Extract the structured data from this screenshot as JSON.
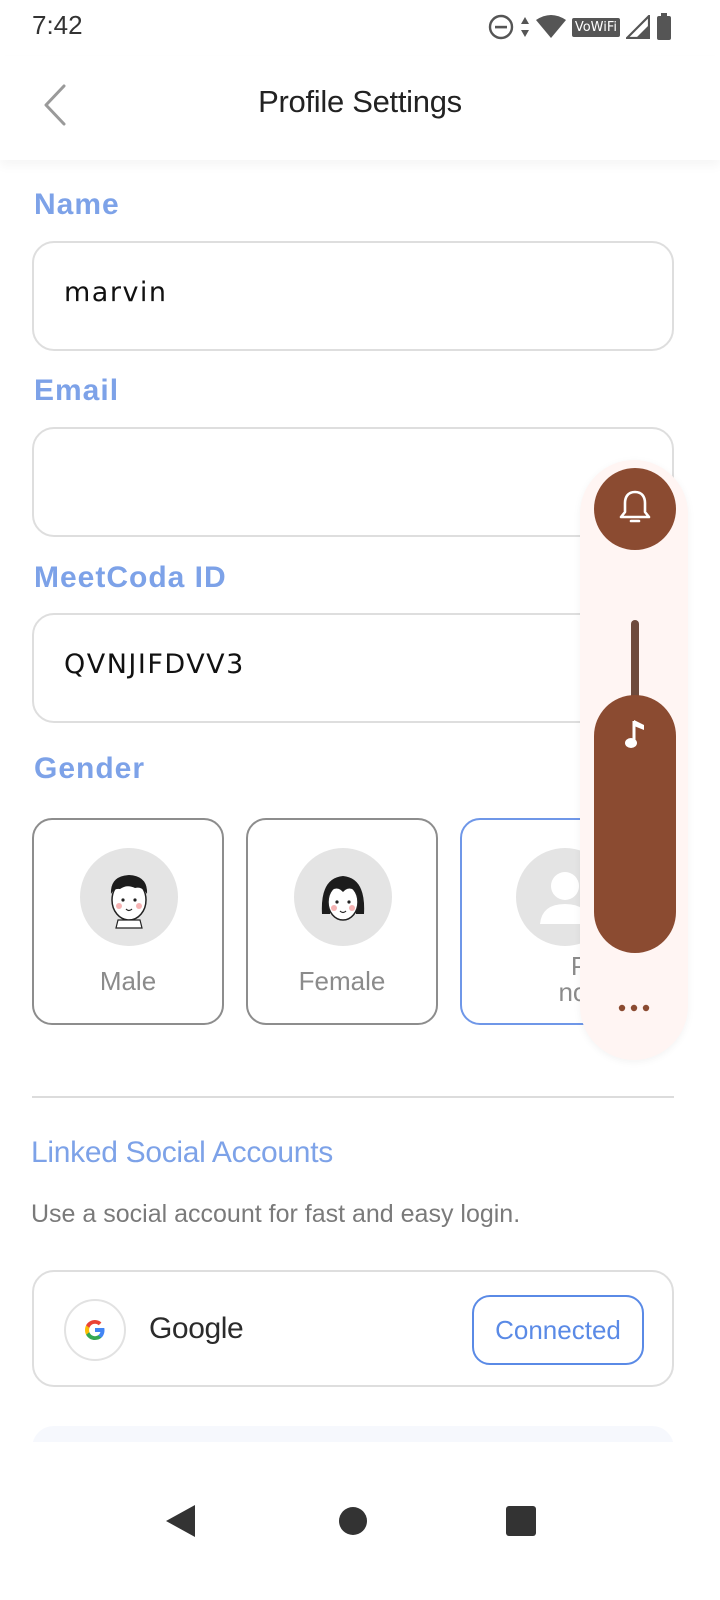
{
  "status_bar": {
    "time": "7:42",
    "vowifi_label": "VoWiFi",
    "icons": [
      "do-not-disturb-icon",
      "data-arrows-icon",
      "wifi-icon",
      "vowifi-icon",
      "signal-icon",
      "battery-icon"
    ]
  },
  "header": {
    "title": "Profile Settings",
    "back_icon": "chevron-left-icon"
  },
  "form": {
    "name_label": "Name",
    "name_value": "marvin",
    "email_label": "Email",
    "email_value": "",
    "id_label": "MeetCoda ID",
    "id_value": "QVNJIFDVV3",
    "gender_label": "Gender",
    "gender_options": [
      {
        "label": "Male",
        "selected": false
      },
      {
        "label": "Female",
        "selected": false
      },
      {
        "label_line1": "Prefe",
        "label_line2": "not to",
        "selected": true
      }
    ]
  },
  "social": {
    "title": "Linked Social Accounts",
    "description": "Use a social account for fast and easy login.",
    "accounts": [
      {
        "provider": "Google",
        "status": "Connected"
      }
    ]
  },
  "volume_panel": {
    "ringer_icon": "bell-icon",
    "media_icon": "music-note-icon",
    "more_icon": "more-dots-icon",
    "accent_color": "#8b4b31"
  },
  "nav_bar": {
    "icons": [
      "back-triangle-icon",
      "home-circle-icon",
      "recents-square-icon"
    ]
  },
  "colors": {
    "label_blue": "#7da2e8",
    "button_blue": "#5a8ae6",
    "volume_brown": "#8b4b31"
  }
}
